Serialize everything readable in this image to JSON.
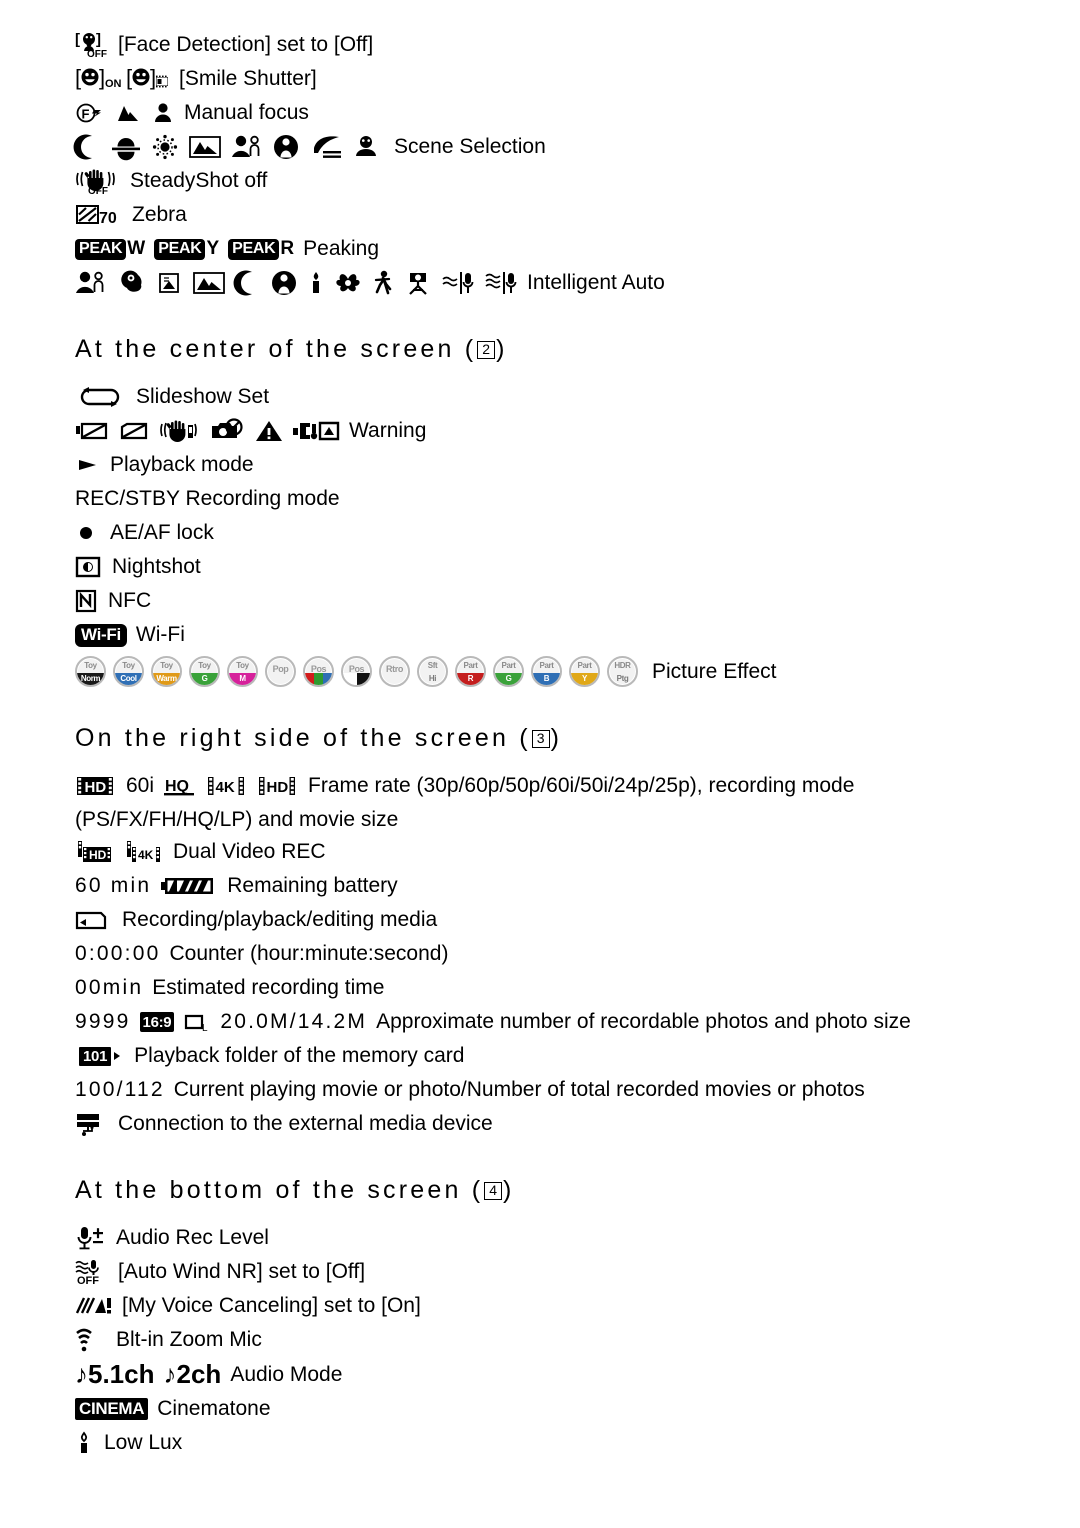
{
  "sections": [
    {
      "id": "top-continued",
      "rows": [
        {
          "icons": [
            "face-detection-off"
          ],
          "label": "[Face Detection] set to [Off]"
        },
        {
          "icons": [
            "smile-shutter-on",
            "smile-shutter-movie"
          ],
          "label": "[Smile Shutter]"
        },
        {
          "icons": [
            "manual-focus-f",
            "manual-focus-mountain",
            "manual-focus-person"
          ],
          "label": "Manual focus"
        },
        {
          "icons": [
            "scene-night",
            "scene-sunrise-sunset",
            "scene-fireworks",
            "scene-landscape",
            "scene-portrait",
            "scene-spotlight",
            "scene-beach",
            "scene-snow"
          ],
          "label": "Scene Selection"
        },
        {
          "icons": [
            "steadyshot-off"
          ],
          "label": "SteadyShot off"
        },
        {
          "icons": [
            "zebra-70"
          ],
          "label": "Zebra"
        },
        {
          "icons": [
            "peak-w",
            "peak-y",
            "peak-r"
          ],
          "label": "Peaking"
        },
        {
          "icons": [
            "ia-portrait",
            "ia-baby",
            "ia-backlight",
            "ia-landscape",
            "ia-night-scene",
            "ia-night-portrait",
            "ia-candle",
            "ia-macro",
            "ia-walk",
            "ia-tripod",
            "ia-mic-low",
            "ia-mic-high"
          ],
          "label": "Intelligent Auto"
        }
      ]
    }
  ],
  "section_center": {
    "heading_before": "At the center of the screen (",
    "heading_number": "2",
    "heading_after": ")",
    "rows": [
      {
        "icons": [
          "slideshow-set"
        ],
        "label": "Slideshow Set"
      },
      {
        "icons": [
          "warn-media-full",
          "warn-media-protected",
          "warn-drop-sensor",
          "warn-photo-disabled",
          "warn-triangle",
          "warn-battery-level"
        ],
        "label": "Warning"
      },
      {
        "icons": [
          "playback-mode"
        ],
        "label": "Playback mode"
      },
      {
        "icons": [],
        "label": "REC/STBY Recording mode"
      },
      {
        "icons": [
          "ae-af-lock"
        ],
        "label": "AE/AF lock"
      },
      {
        "icons": [
          "nightshot"
        ],
        "label": "Nightshot"
      },
      {
        "icons": [
          "nfc"
        ],
        "label": "NFC"
      },
      {
        "icons": [
          "wifi"
        ],
        "label": "Wi-Fi"
      }
    ],
    "picture_effect_label": "Picture Effect",
    "picture_effect_chips": [
      {
        "top": "Toy",
        "bot": "Norm",
        "color": "#1a1a1a"
      },
      {
        "top": "Toy",
        "bot": "Cool",
        "color": "#2f6fb5"
      },
      {
        "top": "Toy",
        "bot": "Warm",
        "color": "#e09a18"
      },
      {
        "top": "Toy",
        "bot": "G",
        "color": "#3aa23a"
      },
      {
        "top": "Toy",
        "bot": "M",
        "color": "#d6219b"
      },
      {
        "top": "Pop",
        "bot": "",
        "color": ""
      },
      {
        "top": "Pos",
        "bot": "",
        "colors": [
          "#d21b1b",
          "#2f9b2f",
          "#2f6fb5"
        ]
      },
      {
        "top": "Pos",
        "bot": "",
        "colors": [
          "#ffffff",
          "#111111"
        ]
      },
      {
        "top": "Rtro",
        "bot": "",
        "color": ""
      },
      {
        "top": "Sft",
        "bot": "Hi",
        "color": ""
      },
      {
        "top": "Part",
        "bot": "R",
        "color": "#c41d1d"
      },
      {
        "top": "Part",
        "bot": "G",
        "color": "#3aa23a"
      },
      {
        "top": "Part",
        "bot": "B",
        "color": "#2f6fb5"
      },
      {
        "top": "Part",
        "bot": "Y",
        "color": "#e0a818"
      },
      {
        "top": "HDR",
        "bot": "Ptg",
        "color": ""
      }
    ]
  },
  "section_right": {
    "heading_before": "On the right side of the screen (",
    "heading_number": "3",
    "heading_after": ")",
    "frame_rate": {
      "icons": [
        "hd-film",
        "hq-underline",
        "4k-film",
        "hd-film-outline"
      ],
      "value_60i": "60i",
      "hq_text": "HQ",
      "k4_text": "4K",
      "hd_text": "HD",
      "line1": "Frame rate (30p/60p/50p/60i/50i/24p/25p), recording mode",
      "line2": "(PS/FX/FH/HQ/LP) and movie size"
    },
    "dual_video": {
      "icons": [
        "dual-hd",
        "dual-4k"
      ],
      "label": "Dual Video REC"
    },
    "battery": {
      "value": "60 min",
      "icons": [
        "battery"
      ],
      "label": "Remaining battery"
    },
    "media": {
      "icons": [
        "media-card"
      ],
      "label": "Recording/playback/editing media"
    },
    "counter": {
      "value": "0:00:00",
      "label": "Counter (hour:minute:second)"
    },
    "estimated": {
      "value": "00min",
      "label": "Estimated recording time"
    },
    "photos": {
      "count": "9999",
      "ratio": "16:9",
      "size": "20.0M/14.2M",
      "label": "Approximate number of recordable photos and photo size"
    },
    "folder": {
      "number": "101",
      "label": "Playback folder of the memory card"
    },
    "playing": {
      "value": "100/112",
      "label": "Current playing movie or photo/Number of total recorded movies or photos"
    },
    "external": {
      "icons": [
        "external-media"
      ],
      "label": "Connection to the external media device"
    }
  },
  "section_bottom": {
    "heading_before": "At the bottom of the screen (",
    "heading_number": "4",
    "heading_after": ")",
    "rows": [
      {
        "icons": [
          "audio-rec-level"
        ],
        "label": "Audio Rec Level"
      },
      {
        "icons": [
          "auto-wind-nr-off"
        ],
        "label": "[Auto Wind NR] set to [Off]"
      },
      {
        "icons": [
          "my-voice-canceling"
        ],
        "label": "[My Voice Canceling] set to [On]"
      },
      {
        "icons": [
          "zoom-mic"
        ],
        "label": "Blt-in Zoom Mic"
      }
    ],
    "audio_mode": {
      "ch51": "5.1ch",
      "ch2": "2ch",
      "label": "Audio Mode"
    },
    "cinematone": {
      "badge": "CINEMA",
      "label": "Cinematone"
    },
    "low_lux": {
      "icons": [
        "low-lux-candle"
      ],
      "label": "Low Lux"
    }
  }
}
